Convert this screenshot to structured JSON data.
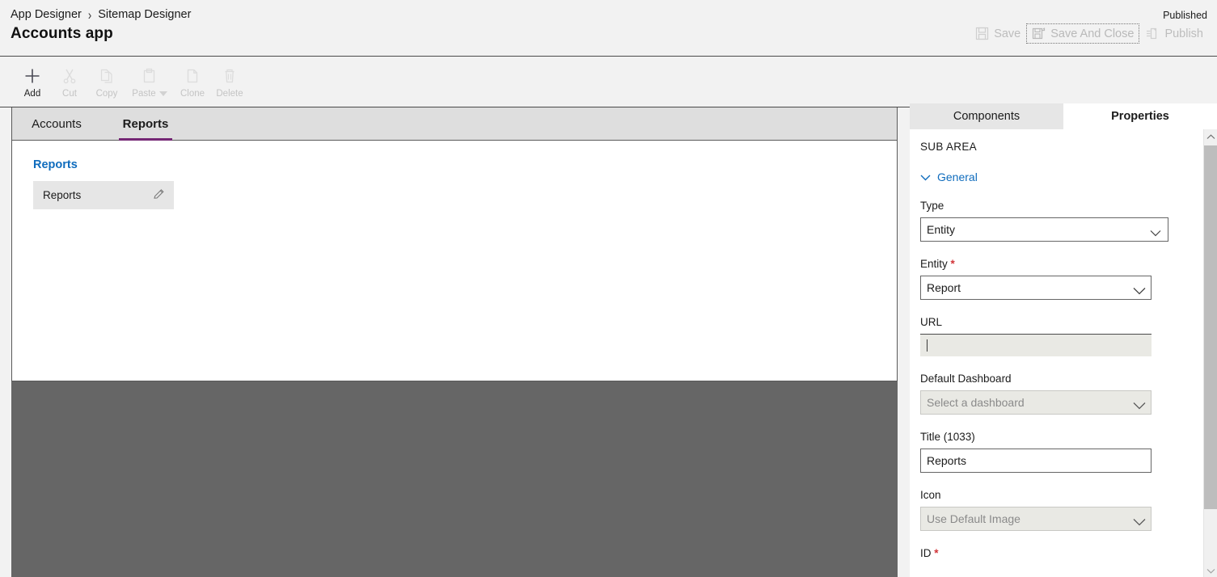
{
  "header": {
    "breadcrumb": [
      {
        "label": "App Designer"
      },
      {
        "label": "Sitemap Designer"
      }
    ],
    "breadcrumb_separator": "›",
    "app_title": "Accounts app",
    "publish_status": "Published",
    "commands": [
      {
        "id": "save",
        "label": "Save",
        "icon": "save-icon",
        "enabled": false,
        "focused": false
      },
      {
        "id": "save-and-close",
        "label": "Save And Close",
        "icon": "save-and-close-icon",
        "enabled": false,
        "focused": true
      },
      {
        "id": "publish",
        "label": "Publish",
        "icon": "publish-icon",
        "enabled": false,
        "focused": false
      }
    ]
  },
  "toolbar": {
    "items": [
      {
        "id": "add",
        "label": "Add",
        "icon": "plus-icon",
        "enabled": true,
        "has_caret": false
      },
      {
        "id": "cut",
        "label": "Cut",
        "icon": "scissors-icon",
        "enabled": false,
        "has_caret": false
      },
      {
        "id": "copy",
        "label": "Copy",
        "icon": "copy-icon",
        "enabled": false,
        "has_caret": false
      },
      {
        "id": "paste",
        "label": "Paste",
        "icon": "clipboard-icon",
        "enabled": false,
        "has_caret": true
      },
      {
        "id": "clone",
        "label": "Clone",
        "icon": "clone-icon",
        "enabled": false,
        "has_caret": false
      },
      {
        "id": "delete",
        "label": "Delete",
        "icon": "trash-icon",
        "enabled": false,
        "has_caret": false
      }
    ]
  },
  "canvas": {
    "tabs": [
      {
        "id": "accounts",
        "label": "Accounts",
        "active": false
      },
      {
        "id": "reports",
        "label": "Reports",
        "active": true
      }
    ],
    "group": {
      "title": "Reports",
      "items": [
        {
          "label": "Reports",
          "edit_icon": "pencil-icon"
        }
      ]
    }
  },
  "panel": {
    "tabs": [
      {
        "id": "components",
        "label": "Components",
        "active": false
      },
      {
        "id": "properties",
        "label": "Properties",
        "active": true
      }
    ],
    "sub_area_label": "SUB AREA",
    "section": {
      "label": "General",
      "expanded": true,
      "chevron": "chevron-down-icon"
    },
    "fields": [
      {
        "id": "type",
        "label": "Type",
        "required": false,
        "control": "select",
        "value": "Entity",
        "placeholder": "",
        "enabled": true,
        "width": "normal"
      },
      {
        "id": "entity",
        "label": "Entity",
        "required": true,
        "control": "select",
        "value": "Report",
        "placeholder": "",
        "enabled": true,
        "width": "wide"
      },
      {
        "id": "url",
        "label": "URL",
        "required": false,
        "control": "text-disabled",
        "value": "",
        "placeholder": "",
        "enabled": false,
        "width": "normal"
      },
      {
        "id": "default-dashboard",
        "label": "Default Dashboard",
        "required": false,
        "control": "select",
        "value": "",
        "placeholder": "Select a dashboard",
        "enabled": false,
        "width": "wide"
      },
      {
        "id": "title",
        "label": "Title (1033)",
        "required": false,
        "control": "text",
        "value": "Reports",
        "placeholder": "",
        "enabled": true,
        "width": "wide"
      },
      {
        "id": "icon",
        "label": "Icon",
        "required": false,
        "control": "select",
        "value": "",
        "placeholder": "Use Default Image",
        "enabled": false,
        "width": "wide"
      },
      {
        "id": "id",
        "label": "ID",
        "required": true,
        "control": "none",
        "value": "",
        "placeholder": "",
        "enabled": true,
        "width": "wide"
      }
    ],
    "scrollbar": {
      "up_icon": "chevron-up-icon",
      "down_icon": "chevron-down-icon"
    }
  },
  "colors": {
    "accent_purple": "#742774",
    "link_blue": "#0f6cbd",
    "required_red": "#d13438",
    "shade_gray": "#666666",
    "chrome_gray": "#f2f2f2"
  }
}
